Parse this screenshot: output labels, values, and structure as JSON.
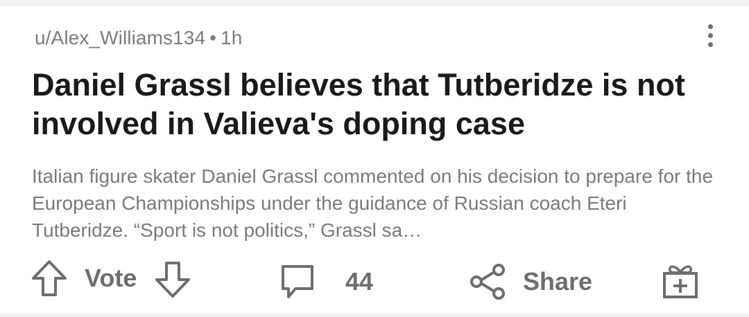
{
  "post": {
    "author": "u/Alex_Williams134",
    "separator": "•",
    "age": "1h",
    "title": "Daniel Grassl believes that Tutberidze is not involved in Valieva's doping case",
    "body": "Italian figure skater Daniel Grassl commented on his decision to prepare for the European Championships under the guidance of Russian coach Eteri Tutberidze.  “Sport is not politics,” Grassl sa…"
  },
  "actions": {
    "vote_label": "Vote",
    "comment_count": "44",
    "share_label": "Share"
  },
  "icons": {
    "more": "more-vertical-icon",
    "upvote": "arrow-up-icon",
    "downvote": "arrow-down-icon",
    "comment": "speech-bubble-icon",
    "share": "share-icon",
    "award": "gift-icon"
  },
  "colors": {
    "title": "#1a1a1a",
    "meta": "#7c7c7c",
    "icon": "#6e6e6e"
  }
}
